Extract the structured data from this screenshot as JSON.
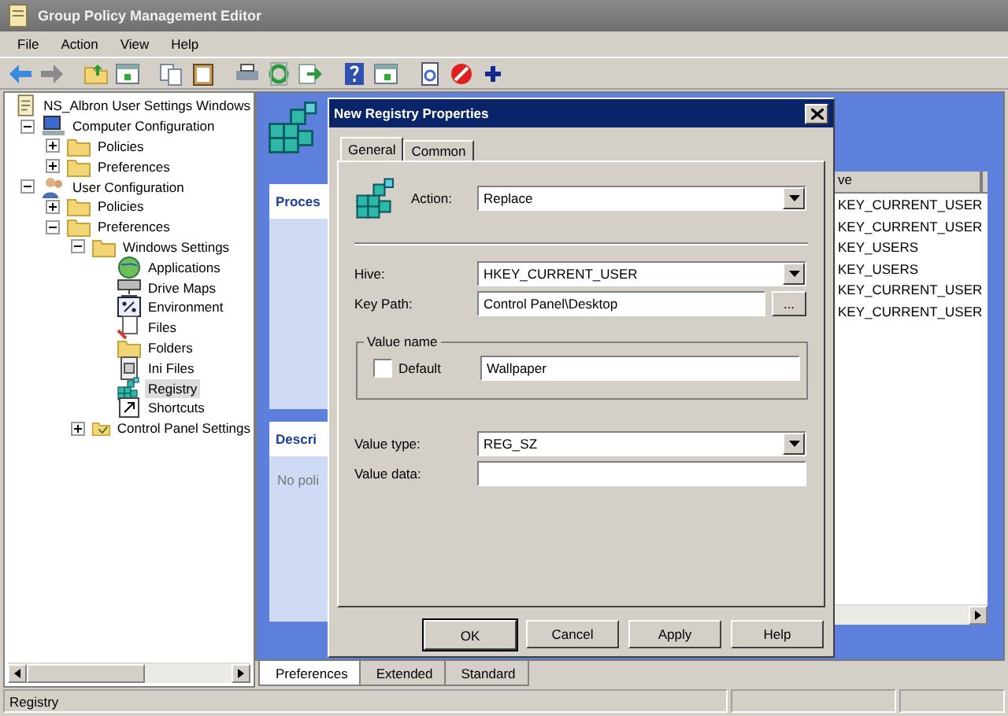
{
  "window": {
    "title": "Group Policy Management Editor"
  },
  "menu": [
    "File",
    "Action",
    "View",
    "Help"
  ],
  "tree": {
    "label": "NS_Albron User Settings Windows",
    "kind": "document",
    "children": [
      {
        "label": "Computer Configuration",
        "kind": "computer",
        "expanded": true,
        "children": [
          {
            "label": "Policies",
            "kind": "folder",
            "expanded": false
          },
          {
            "label": "Preferences",
            "kind": "folder",
            "expanded": false
          }
        ]
      },
      {
        "label": "User Configuration",
        "kind": "user",
        "expanded": true,
        "children": [
          {
            "label": "Policies",
            "kind": "folder",
            "expanded": false
          },
          {
            "label": "Preferences",
            "kind": "folder",
            "expanded": true,
            "children": [
              {
                "label": "Windows Settings",
                "kind": "folder",
                "expanded": true,
                "children": [
                  {
                    "label": "Applications",
                    "kind": "globe",
                    "selected": false
                  },
                  {
                    "label": "Drive Maps",
                    "kind": "drive",
                    "selected": false
                  },
                  {
                    "label": "Environment",
                    "kind": "env",
                    "selected": false
                  },
                  {
                    "label": "Files",
                    "kind": "files",
                    "selected": false
                  },
                  {
                    "label": "Folders",
                    "kind": "folder",
                    "selected": false
                  },
                  {
                    "label": "Ini Files",
                    "kind": "ini",
                    "selected": false
                  },
                  {
                    "label": "Registry",
                    "kind": "registry",
                    "selected": true
                  },
                  {
                    "label": "Shortcuts",
                    "kind": "shortcut",
                    "selected": false
                  }
                ]
              },
              {
                "label": "Control Panel Settings",
                "kind": "panel",
                "expanded": false
              }
            ]
          }
        ]
      }
    ]
  },
  "right_pane": {
    "process_heading": "Proces",
    "description_heading": "Descri",
    "description_text": "No poli",
    "list": {
      "column": "ve",
      "rows": [
        "KEY_CURRENT_USER",
        "KEY_CURRENT_USER",
        "KEY_USERS",
        "KEY_USERS",
        "KEY_CURRENT_USER",
        "KEY_CURRENT_USER"
      ]
    }
  },
  "dialog": {
    "title": "New Registry Properties",
    "tabs": [
      {
        "label": "General",
        "selected": true
      },
      {
        "label": "Common",
        "selected": false
      }
    ],
    "action": {
      "label": "Action:",
      "value": "Replace"
    },
    "hive": {
      "label": "Hive:",
      "value": "HKEY_CURRENT_USER"
    },
    "key_path": {
      "label": "Key Path:",
      "value": "Control Panel\\Desktop",
      "browse": "..."
    },
    "value_name": {
      "legend": "Value name",
      "default": {
        "label": "Default",
        "checked": false
      },
      "value": "Wallpaper"
    },
    "value_type": {
      "label": "Value type:",
      "value": "REG_SZ"
    },
    "value_data": {
      "label": "Value data:"
    },
    "buttons": [
      "OK",
      "Cancel",
      "Apply",
      "Help"
    ]
  },
  "bottom_tabs": [
    {
      "label": "Preferences",
      "selected": true
    },
    {
      "label": "Extended",
      "selected": false
    },
    {
      "label": "Standard",
      "selected": false
    }
  ],
  "status_bar": [
    "Registry"
  ]
}
